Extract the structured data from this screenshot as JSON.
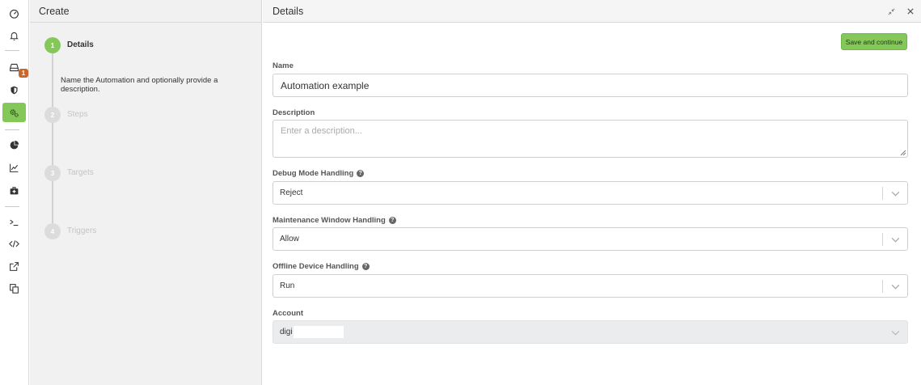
{
  "rail": {
    "items": [
      {
        "icon": "dashboard-icon"
      },
      {
        "icon": "bell-icon"
      },
      {
        "icon": "inbox-icon",
        "badge": "1"
      },
      {
        "icon": "shield-icon"
      },
      {
        "icon": "gears-icon",
        "active": true
      },
      {
        "icon": "pie-chart-icon"
      },
      {
        "icon": "line-chart-icon"
      },
      {
        "icon": "medkit-icon"
      },
      {
        "icon": "terminal-icon"
      },
      {
        "icon": "code-icon"
      },
      {
        "icon": "external-link-icon"
      },
      {
        "icon": "copy-icon"
      }
    ],
    "active_color": "#85c85a",
    "badge_color": "#c8682c"
  },
  "steps_panel": {
    "title": "Create",
    "steps": [
      {
        "number": "1",
        "label": "Details",
        "active": true
      },
      {
        "number": "2",
        "label": "Steps",
        "active": false
      },
      {
        "number": "3",
        "label": "Targets",
        "active": false
      },
      {
        "number": "4",
        "label": "Triggers",
        "active": false
      }
    ],
    "description": "Name the Automation and optionally provide a description."
  },
  "details": {
    "title": "Details",
    "save_label": "Save and continue",
    "name_label": "Name",
    "name_value": "Automation example",
    "description_label": "Description",
    "description_placeholder": "Enter a description...",
    "debug_label": "Debug Mode Handling",
    "debug_value": "Reject",
    "maintenance_label": "Maintenance Window Handling",
    "maintenance_value": "Allow",
    "offline_label": "Offline Device Handling",
    "offline_value": "Run",
    "account_label": "Account",
    "account_value": "digi",
    "help_glyph": "?"
  }
}
